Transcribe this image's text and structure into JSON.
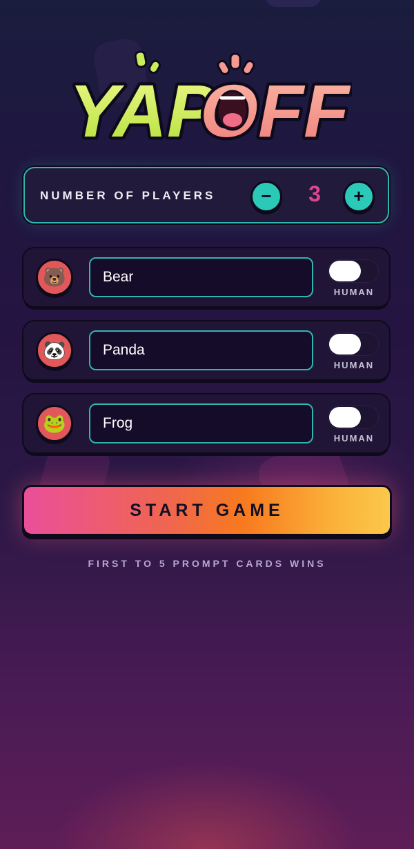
{
  "app": {
    "logo_text": "YAPOFF"
  },
  "players": {
    "label": "NUMBER OF PLAYERS",
    "count": "3",
    "decrement_symbol": "−",
    "increment_symbol": "+"
  },
  "player_list": [
    {
      "emoji": "🐻",
      "name": "Bear",
      "toggle_label": "HUMAN",
      "toggle_on": false
    },
    {
      "emoji": "🐼",
      "name": "Panda",
      "toggle_label": "HUMAN",
      "toggle_on": false
    },
    {
      "emoji": "🐸",
      "name": "Frog",
      "toggle_label": "HUMAN",
      "toggle_on": false
    }
  ],
  "start_button": {
    "label": "START GAME"
  },
  "footer_hint": "FIRST TO 5 PROMPT CARDS WINS",
  "colors": {
    "accent_teal": "#2bc9b8",
    "count_pink": "#e0458f",
    "avatar_red": "#e2585a",
    "logo_green": "#d6f06a",
    "logo_pink": "#f59a92"
  },
  "icons": [
    "minus-icon",
    "plus-icon",
    "bear-emoji",
    "panda-emoji",
    "frog-emoji",
    "toggle-knob"
  ]
}
